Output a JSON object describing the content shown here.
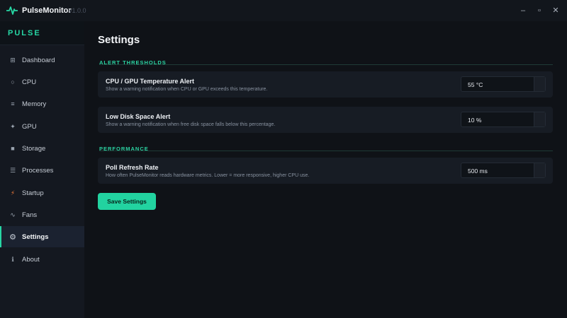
{
  "window": {
    "app_name": "PulseMonitor",
    "version": "v1.0.0",
    "controls": {
      "minimize": "–",
      "maximize": "▫",
      "close": "✕"
    }
  },
  "sidebar": {
    "brand": "PULSE",
    "items": [
      {
        "label": "Dashboard",
        "icon": "dashboard-icon",
        "glyph": "⊞",
        "active": false
      },
      {
        "label": "CPU",
        "icon": "cpu-icon",
        "glyph": "○",
        "active": false
      },
      {
        "label": "Memory",
        "icon": "memory-icon",
        "glyph": "≡",
        "active": false
      },
      {
        "label": "GPU",
        "icon": "gpu-icon",
        "glyph": "✦",
        "active": false
      },
      {
        "label": "Storage",
        "icon": "storage-icon",
        "glyph": "■",
        "active": false
      },
      {
        "label": "Processes",
        "icon": "processes-icon",
        "glyph": "☰",
        "active": false
      },
      {
        "label": "Startup",
        "icon": "lightning-icon",
        "glyph": "⚡",
        "active": false
      },
      {
        "label": "Fans",
        "icon": "fan-icon",
        "glyph": "∿",
        "active": false
      },
      {
        "label": "Settings",
        "icon": "gear-icon",
        "glyph": "⚙",
        "active": true
      },
      {
        "label": "About",
        "icon": "info-icon",
        "glyph": "ℹ",
        "active": false
      }
    ]
  },
  "main": {
    "title": "Settings",
    "sections": [
      {
        "heading": "ALERT THRESHOLDS",
        "rows": [
          {
            "title": "CPU / GPU Temperature Alert",
            "description": "Show a warning notification when CPU or GPU exceeds this temperature.",
            "value": "55 °C"
          },
          {
            "title": "Low Disk Space Alert",
            "description": "Show a warning notification when free disk space falls below this percentage.",
            "value": "10 %"
          }
        ]
      },
      {
        "heading": "PERFORMANCE",
        "rows": [
          {
            "title": "Poll Refresh Rate",
            "description": "How often PulseMonitor reads hardware metrics. Lower = more responsive, higher CPU use.",
            "value": "500 ms"
          }
        ]
      }
    ],
    "save_label": "Save Settings"
  },
  "colors": {
    "accent": "#27d6a4",
    "background": "#0f1217",
    "sidebar": "#141820",
    "card": "#171c24",
    "startup_icon": "#f07a3a"
  }
}
